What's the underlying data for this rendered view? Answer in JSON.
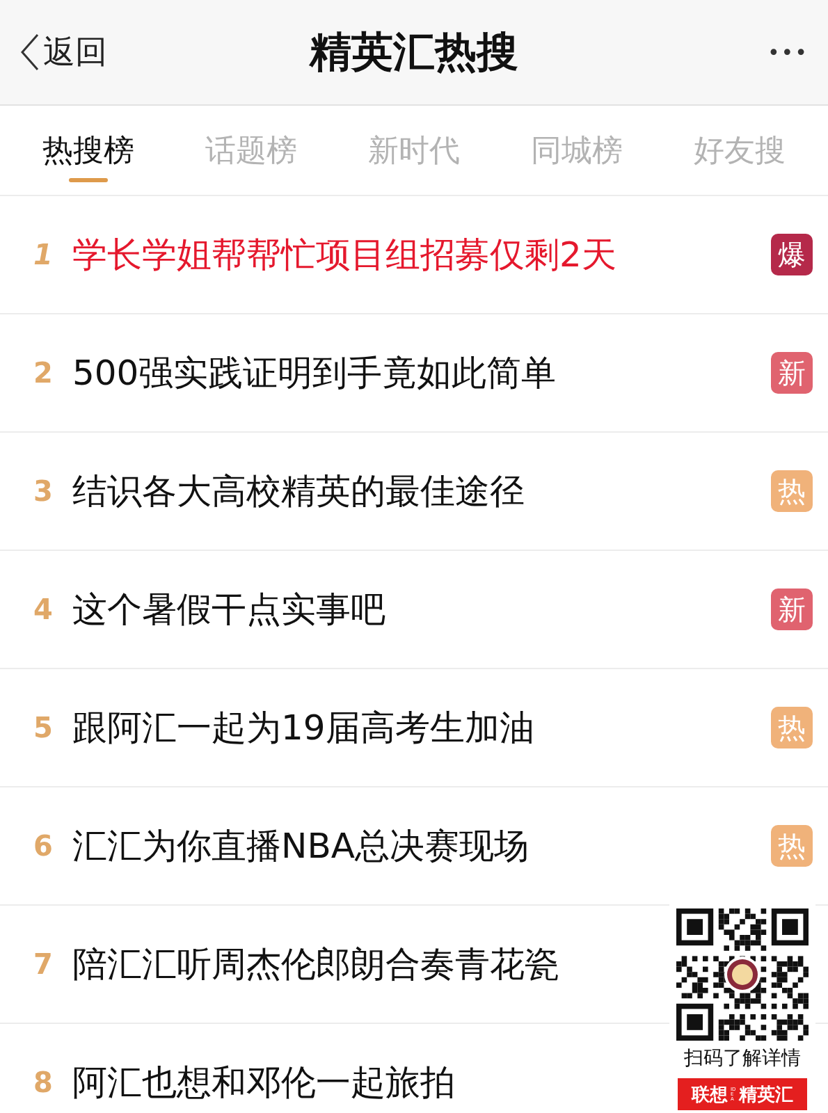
{
  "header": {
    "back": "返回",
    "title": "精英汇热搜",
    "more": "•••"
  },
  "tabs": [
    {
      "label": "热搜榜",
      "selected": true
    },
    {
      "label": "话题榜",
      "selected": false
    },
    {
      "label": "新时代",
      "selected": false
    },
    {
      "label": "同城榜",
      "selected": false
    },
    {
      "label": "好友搜",
      "selected": false
    }
  ],
  "items": [
    {
      "rank": "1",
      "title": "学长学姐帮帮忙项目组招募仅剩2天",
      "highlighted": true,
      "badge": {
        "kind": "boom",
        "label": "爆"
      }
    },
    {
      "rank": "2",
      "title": "500强实践证明到手竟如此简单",
      "highlighted": false,
      "badge": {
        "kind": "new",
        "label": "新"
      }
    },
    {
      "rank": "3",
      "title": "结识各大高校精英的最佳途径",
      "highlighted": false,
      "badge": {
        "kind": "hot",
        "label": "热"
      }
    },
    {
      "rank": "4",
      "title": "这个暑假干点实事吧",
      "highlighted": false,
      "badge": {
        "kind": "new",
        "label": "新"
      }
    },
    {
      "rank": "5",
      "title": "跟阿汇一起为19届高考生加油",
      "highlighted": false,
      "badge": {
        "kind": "hot",
        "label": "热"
      }
    },
    {
      "rank": "6",
      "title": "汇汇为你直播NBA总决赛现场",
      "highlighted": false,
      "badge": {
        "kind": "hot",
        "label": "热"
      }
    },
    {
      "rank": "7",
      "title": "陪汇汇听周杰伦郎朗合奏青花瓷",
      "highlighted": false
    },
    {
      "rank": "8",
      "title": "阿汇也想和邓伦一起旅拍",
      "highlighted": false
    }
  ],
  "qr_card": {
    "caption": "扫码了解详情",
    "brand": [
      "联想",
      "IDEA",
      "精英汇"
    ]
  }
}
